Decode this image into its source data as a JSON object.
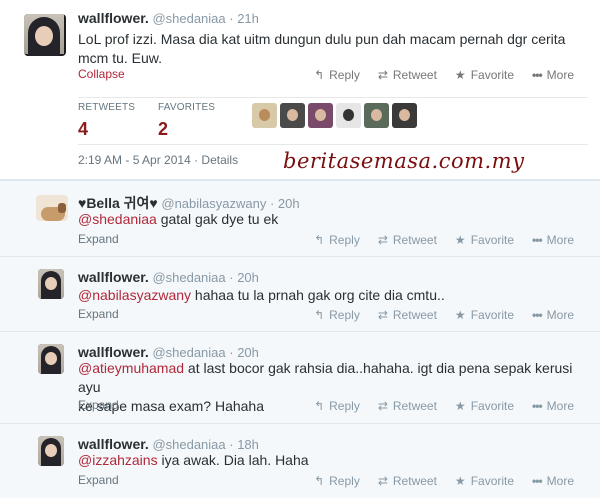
{
  "main_tweet": {
    "name": "wallflower.",
    "handle": "@shedaniaa",
    "time": "· 21h",
    "text_line1": "LoL prof izzi. Masa dia kat uitm dungun dulu pun dah macam pernah dgr cerita",
    "text_line2": "mcm tu. Euw.",
    "collapse": "Collapse",
    "actions": {
      "reply": "Reply",
      "retweet": "Retweet",
      "favorite": "Favorite",
      "more": "More"
    },
    "stats": {
      "retweets_label": "RETWEETS",
      "retweets": "4",
      "favorites_label": "FAVORITES",
      "favorites": "2"
    },
    "datetime": "2:19 AM - 5 Apr 2014 · Details",
    "watermark": "beritasemasa.com.my"
  },
  "replies": [
    {
      "name": "♥Bella 귀여♥",
      "handle": "@nabilasyazwany",
      "time": "· 20h",
      "mention": "@shedaniaa",
      "text": " gatal gak dye tu ek",
      "text_line2": "",
      "expand": "Expand"
    },
    {
      "name": "wallflower.",
      "handle": "@shedaniaa",
      "time": "· 20h",
      "mention": "@nabilasyazwany",
      "text": " hahaa tu la prnah gak org cite dia cmtu..",
      "text_line2": "",
      "expand": "Expand"
    },
    {
      "name": "wallflower.",
      "handle": "@shedaniaa",
      "time": "· 20h",
      "mention": "@atieymuhamad",
      "text": " at last bocor gak rahsia dia..hahaha. igt dia pena sepak kerusi ayu",
      "text_line2": "ke sape masa exam? Hahaha",
      "expand": "Expand"
    },
    {
      "name": "wallflower.",
      "handle": "@shedaniaa",
      "time": "· 18h",
      "mention": "@izzahzains",
      "text": " iya awak. Dia lah. Haha",
      "text_line2": "",
      "expand": "Expand"
    }
  ],
  "reply_actions": {
    "reply": "Reply",
    "retweet": "Retweet",
    "favorite": "Favorite",
    "more": "More"
  },
  "colors": {
    "mention": "#b0283a",
    "stat_value": "#8b1a1a",
    "watermark": "#7a0e0e",
    "reply_bg": "#f5f8fa"
  }
}
